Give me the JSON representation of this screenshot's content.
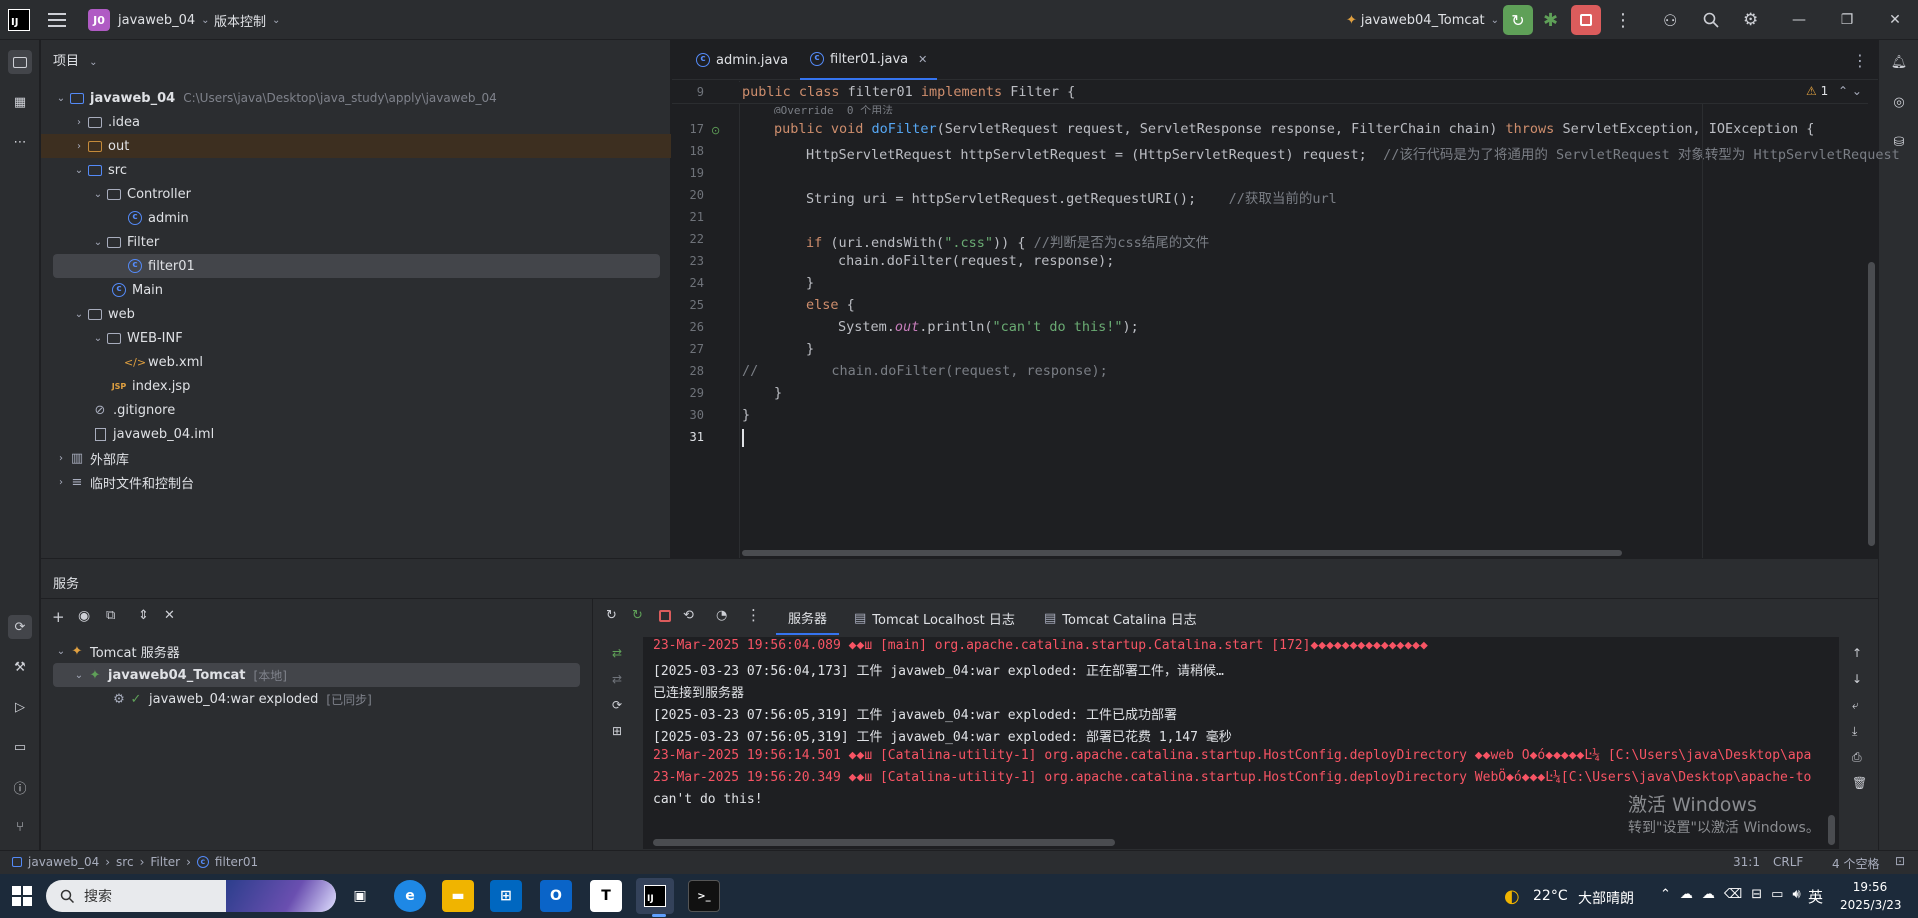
{
  "titlebar": {
    "project_badge": "J0",
    "project_name": "javaweb_04",
    "vcs_label": "版本控制",
    "run_config": "javaweb04_Tomcat"
  },
  "project_panel": {
    "title": "项目",
    "tree": [
      {
        "label": "javaweb_04",
        "hint": "C:\\Users\\java\\Desktop\\java_study\\apply\\javaweb_04"
      },
      {
        "label": ".idea"
      },
      {
        "label": "out"
      },
      {
        "label": "src"
      },
      {
        "label": "Controller"
      },
      {
        "label": "admin"
      },
      {
        "label": "Filter"
      },
      {
        "label": "filter01"
      },
      {
        "label": "Main"
      },
      {
        "label": "web"
      },
      {
        "label": "WEB-INF"
      },
      {
        "label": "web.xml"
      },
      {
        "label": "index.jsp"
      },
      {
        "label": ".gitignore"
      },
      {
        "label": "javaweb_04.iml"
      },
      {
        "label": "外部库"
      },
      {
        "label": "临时文件和控制台"
      }
    ]
  },
  "editor": {
    "tabs": [
      {
        "label": "admin.java"
      },
      {
        "label": "filter01.java"
      }
    ],
    "warning_count": "1",
    "sticky_line_num": "9",
    "sticky_line": "public class filter01 implements Filter {",
    "hint_line": "@Override  0 个用法",
    "lines": [
      {
        "n": "17"
      },
      {
        "n": "18"
      },
      {
        "n": "19"
      },
      {
        "n": "20"
      },
      {
        "n": "21"
      },
      {
        "n": "22"
      },
      {
        "n": "23"
      },
      {
        "n": "24"
      },
      {
        "n": "25"
      },
      {
        "n": "26"
      },
      {
        "n": "27"
      },
      {
        "n": "28"
      },
      {
        "n": "29"
      },
      {
        "n": "30"
      },
      {
        "n": "31"
      }
    ],
    "code": {
      "l17_a": "public void ",
      "l17_fn": "doFilter",
      "l17_b": "(ServletRequest request, ServletResponse response, FilterChain chain) ",
      "l17_kw": "throws",
      "l17_c": " ServletException, IOException {",
      "l18": "HttpServletRequest httpServletRequest = (HttpServletRequest) request;",
      "l18_cm": "//该行代码是为了将通用的 ServletRequest 对象转型为 HttpServletRequest",
      "l20": "String uri = httpServletRequest.getRequestURI();",
      "l20_cm": "//获取当前的url",
      "l22_kw": "if",
      "l22_a": " (uri.endsWith(",
      "l22_str": "\".css\"",
      "l22_b": ")) { ",
      "l22_cm": "//判断是否为css结尾的文件",
      "l23": "chain.doFilter(request, response);",
      "l24": "}",
      "l25_kw": "else",
      "l25": " {",
      "l26_a": "System.",
      "l26_st": "out",
      "l26_b": ".println(",
      "l26_str": "\"can't do this!\"",
      "l26_c": ");",
      "l27": "}",
      "l28": "//         chain.doFilter(request, response);",
      "l29": "}",
      "l30": "}"
    }
  },
  "services": {
    "title": "服务",
    "tree": [
      {
        "label": "Tomcat 服务器"
      },
      {
        "label": "javaweb04_Tomcat",
        "hint": "[本地]"
      },
      {
        "label": "javaweb_04:war exploded",
        "hint": "[已同步]"
      }
    ],
    "console_tabs": [
      {
        "label": "服务器"
      },
      {
        "label": "Tomcat Localhost 日志"
      },
      {
        "label": "Tomcat Catalina 日志"
      }
    ],
    "log": [
      {
        "text": "23-Mar-2025 19:56:04.089 ◆◆ш [main] org.apache.catalina.startup.Catalina.start [172]◆◆◆◆◆◆◆◆◆◆◆◆◆◆◆",
        "level": "red"
      },
      {
        "text": "[2025-03-23 07:56:04,173] 工件 javaweb_04:war exploded: 正在部署工件，请稍候…",
        "level": "white"
      },
      {
        "text": "已连接到服务器",
        "level": "white"
      },
      {
        "text": "[2025-03-23 07:56:05,319] 工件 javaweb_04:war exploded: 工件已成功部署",
        "level": "white"
      },
      {
        "text": "[2025-03-23 07:56:05,319] 工件 javaweb_04:war exploded: 部署已花费 1,147 毫秒",
        "level": "white"
      },
      {
        "text": "23-Mar-2025 19:56:14.501 ◆◆ш [Catalina-utility-1] org.apache.catalina.startup.HostConfig.deployDirectory ◆◆web Ö◆ó◆◆◆◆◆Ŀ¼ [C:\\Users\\java\\Desktop\\apa",
        "level": "red"
      },
      {
        "text": "23-Mar-2025 19:56:20.349 ◆◆ш [Catalina-utility-1] org.apache.catalina.startup.HostConfig.deployDirectory WebÖ◆ó◆◆◆Ŀ¼[C:\\Users\\java\\Desktop\\apache-to",
        "level": "red"
      },
      {
        "text": "can't do this!",
        "level": "white"
      }
    ],
    "watermark_title": "激活 Windows",
    "watermark_sub": "转到\"设置\"以激活 Windows。"
  },
  "statusbar": {
    "breadcrumb": [
      "javaweb_04",
      "src",
      "Filter",
      "filter01"
    ],
    "position": "31:1",
    "line_ending": "CRLF",
    "indent": "4 个空格"
  },
  "taskbar": {
    "search": "搜索",
    "weather": "22°C",
    "weather_desc": "大部晴朗",
    "ime": "英",
    "time": "19:56",
    "date": "2025/3/23"
  },
  "colors": {
    "accent": "#3574f0",
    "run_green": "#5fa058",
    "stop_red": "#db5c5c",
    "error_red": "#f75464"
  }
}
